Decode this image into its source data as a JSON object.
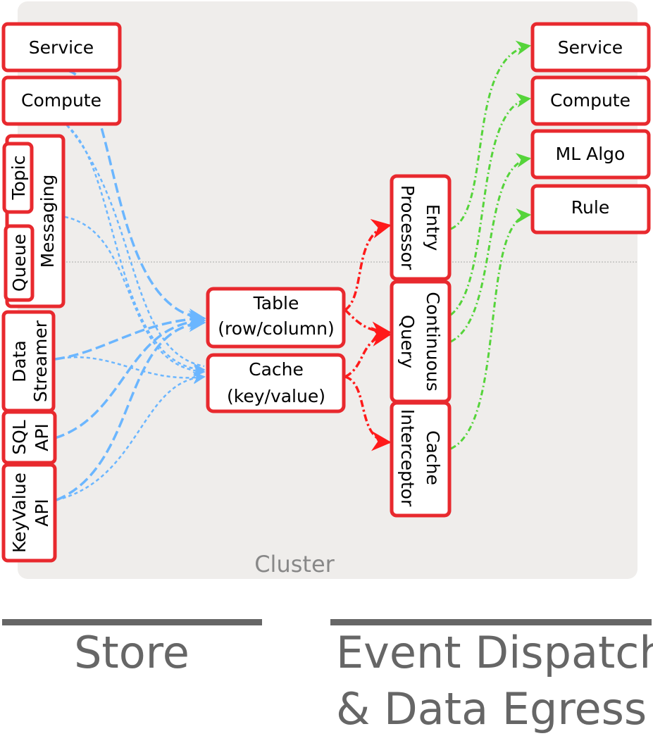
{
  "colors": {
    "box_border": "#e8292e",
    "cluster_bg": "#efedeb",
    "ingress_edge": "#6bb6ff",
    "internal_edge": "#ff1a1a",
    "egress_edge": "#55d43a",
    "caption": "#666666"
  },
  "cluster": {
    "label": "Cluster"
  },
  "sources": {
    "service": "Service",
    "compute": "Compute",
    "messaging": "Messaging",
    "topic": "Topic",
    "queue": "Queue",
    "data_streamer": [
      "Data",
      "Streamer"
    ],
    "sql_api": [
      "SQL",
      "API"
    ],
    "keyvalue_api": [
      "KeyValue",
      "API"
    ]
  },
  "storage": {
    "table": [
      "Table",
      "(row/column)"
    ],
    "cache": [
      "Cache",
      "(key/value)"
    ]
  },
  "processors": {
    "entry_processor": [
      "Entry",
      "Processor"
    ],
    "continuous_query": [
      "Continuous",
      "Query"
    ],
    "cache_interceptor": [
      "Cache",
      "Interceptor"
    ]
  },
  "targets": {
    "service": "Service",
    "compute": "Compute",
    "ml_algo": "ML Algo",
    "rule": "Rule"
  },
  "captions": {
    "store": "Store",
    "egress": [
      "Event Dispatch",
      "& Data Egress"
    ]
  }
}
